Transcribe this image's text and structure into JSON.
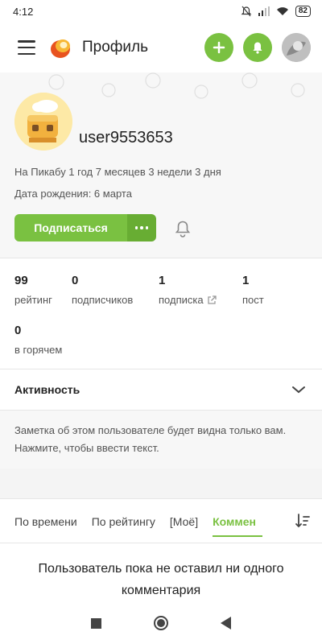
{
  "status_bar": {
    "time": "4:12",
    "battery": "82"
  },
  "header": {
    "title": "Профиль"
  },
  "profile": {
    "username": "user9553653",
    "membership": "На Пикабу 1 год 7 месяцев 3 недели 3 дня",
    "birthday": "Дата рождения: 6 марта",
    "subscribe_label": "Подписаться"
  },
  "stats": [
    {
      "value": "99",
      "label": "рейтинг"
    },
    {
      "value": "0",
      "label": "подписчиков"
    },
    {
      "value": "1",
      "label": "подписка"
    },
    {
      "value": "1",
      "label": "пост"
    },
    {
      "value": "0",
      "label": "в горячем"
    }
  ],
  "activity": {
    "title": "Активность"
  },
  "note": {
    "text": "Заметка об этом пользователе будет видна только вам. Нажмите, чтобы ввести текст."
  },
  "tabs": [
    {
      "label": "По времени"
    },
    {
      "label": "По рейтингу"
    },
    {
      "label": "[Моё]"
    },
    {
      "label": "Коммен"
    }
  ],
  "empty_message": "Пользователь пока не оставил ни одного комментария",
  "colors": {
    "accent": "#7ac141",
    "accent_dark": "#68ad33"
  },
  "icons": [
    "menu-icon",
    "pikabu-logo",
    "plus-icon",
    "bell-icon",
    "avatar",
    "bell-outline-icon",
    "external-link-icon",
    "chevron-down-icon",
    "sort-icon"
  ]
}
